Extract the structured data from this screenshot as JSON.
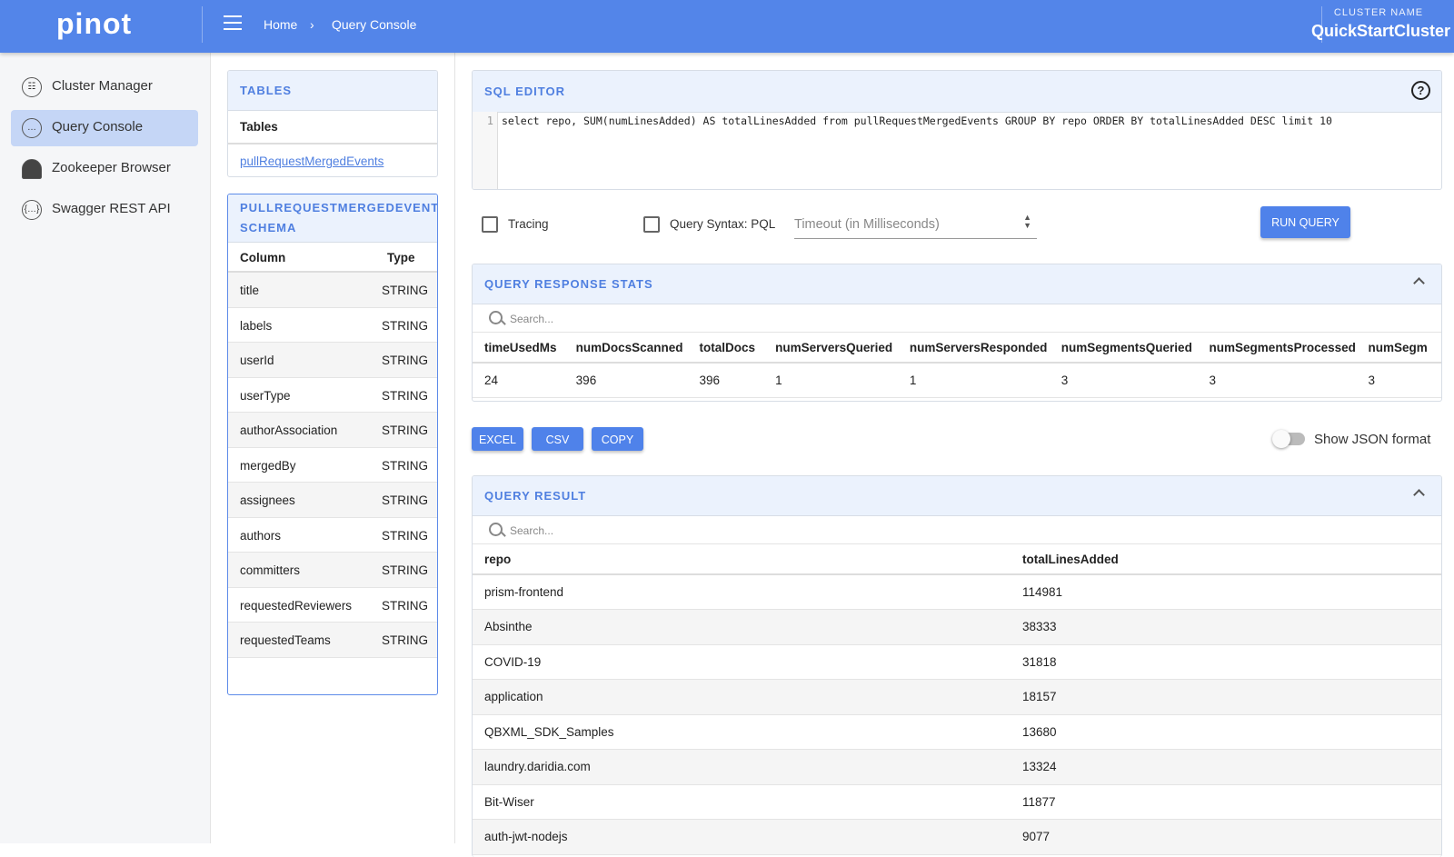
{
  "header": {
    "logo": "pinot",
    "breadcrumb": [
      "Home",
      "Query Console"
    ],
    "cluster_label": "CLUSTER NAME",
    "cluster_name": "QuickStartCluster"
  },
  "sidebar": {
    "items": [
      {
        "label": "Cluster Manager",
        "icon": "cluster-icon"
      },
      {
        "label": "Query Console",
        "icon": "query-icon",
        "active": true
      },
      {
        "label": "Zookeeper Browser",
        "icon": "zookeeper-icon"
      },
      {
        "label": "Swagger REST API",
        "icon": "swagger-icon"
      }
    ]
  },
  "tables": {
    "title": "TABLES",
    "header": "Tables",
    "items": [
      "pullRequestMergedEvents"
    ]
  },
  "schema": {
    "title": "PULLREQUESTMERGEDEVENTS SCHEMA",
    "columns": [
      "Column",
      "Type"
    ],
    "rows": [
      [
        "title",
        "STRING"
      ],
      [
        "labels",
        "STRING"
      ],
      [
        "userId",
        "STRING"
      ],
      [
        "userType",
        "STRING"
      ],
      [
        "authorAssociation",
        "STRING"
      ],
      [
        "mergedBy",
        "STRING"
      ],
      [
        "assignees",
        "STRING"
      ],
      [
        "authors",
        "STRING"
      ],
      [
        "committers",
        "STRING"
      ],
      [
        "requestedReviewers",
        "STRING"
      ],
      [
        "requestedTeams",
        "STRING"
      ]
    ]
  },
  "editor": {
    "title": "SQL EDITOR",
    "line_number": "1",
    "query": "select repo, SUM(numLinesAdded) AS totalLinesAdded from pullRequestMergedEvents GROUP BY repo ORDER BY totalLinesAdded DESC  limit 10",
    "help_icon": "help-circle-icon"
  },
  "options": {
    "tracing": "Tracing",
    "tracing_checked": false,
    "pql": "Query Syntax: PQL",
    "pql_checked": false,
    "timeout_placeholder": "Timeout (in Milliseconds)",
    "run": "RUN QUERY"
  },
  "stats": {
    "title": "QUERY RESPONSE STATS",
    "search_placeholder": "Search...",
    "columns": [
      "timeUsedMs",
      "numDocsScanned",
      "totalDocs",
      "numServersQueried",
      "numServersResponded",
      "numSegmentsQueried",
      "numSegmentsProcessed",
      "numSegm"
    ],
    "values": [
      "24",
      "396",
      "396",
      "1",
      "1",
      "3",
      "3",
      "3"
    ]
  },
  "export": {
    "excel": "EXCEL",
    "csv": "CSV",
    "copy": "COPY",
    "json_toggle": "Show JSON format",
    "json_on": false
  },
  "result": {
    "title": "QUERY RESULT",
    "search_placeholder": "Search...",
    "columns": [
      "repo",
      "totalLinesAdded"
    ],
    "rows": [
      [
        "prism-frontend",
        "114981"
      ],
      [
        "Absinthe",
        "38333"
      ],
      [
        "COVID-19",
        "31818"
      ],
      [
        "application",
        "18157"
      ],
      [
        "QBXML_SDK_Samples",
        "13680"
      ],
      [
        "laundry.daridia.com",
        "13324"
      ],
      [
        "Bit-Wiser",
        "11877"
      ],
      [
        "auth-jwt-nodejs",
        "9077"
      ]
    ]
  }
}
